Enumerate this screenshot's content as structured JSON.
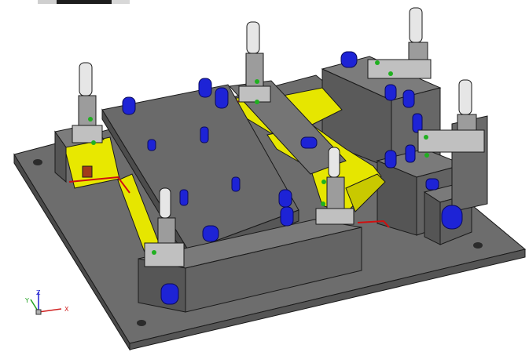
{
  "window": {
    "background": "#ffffff"
  },
  "triad": {
    "x_label": "X",
    "y_label": "Y",
    "z_label": "Z",
    "x_color": "#d02020",
    "y_color": "#20a020",
    "z_color": "#2020d0"
  },
  "icons": {
    "triad": "axis-triad-icon",
    "tab_strip": "tab-strip"
  },
  "colors": {
    "base_plate": "#6f6f6f",
    "block": "#5e5e5e",
    "part": "#e6e600",
    "pin": "#1d23d6",
    "clamp": "#9a9a9a",
    "edge": "#1a1a1a"
  }
}
